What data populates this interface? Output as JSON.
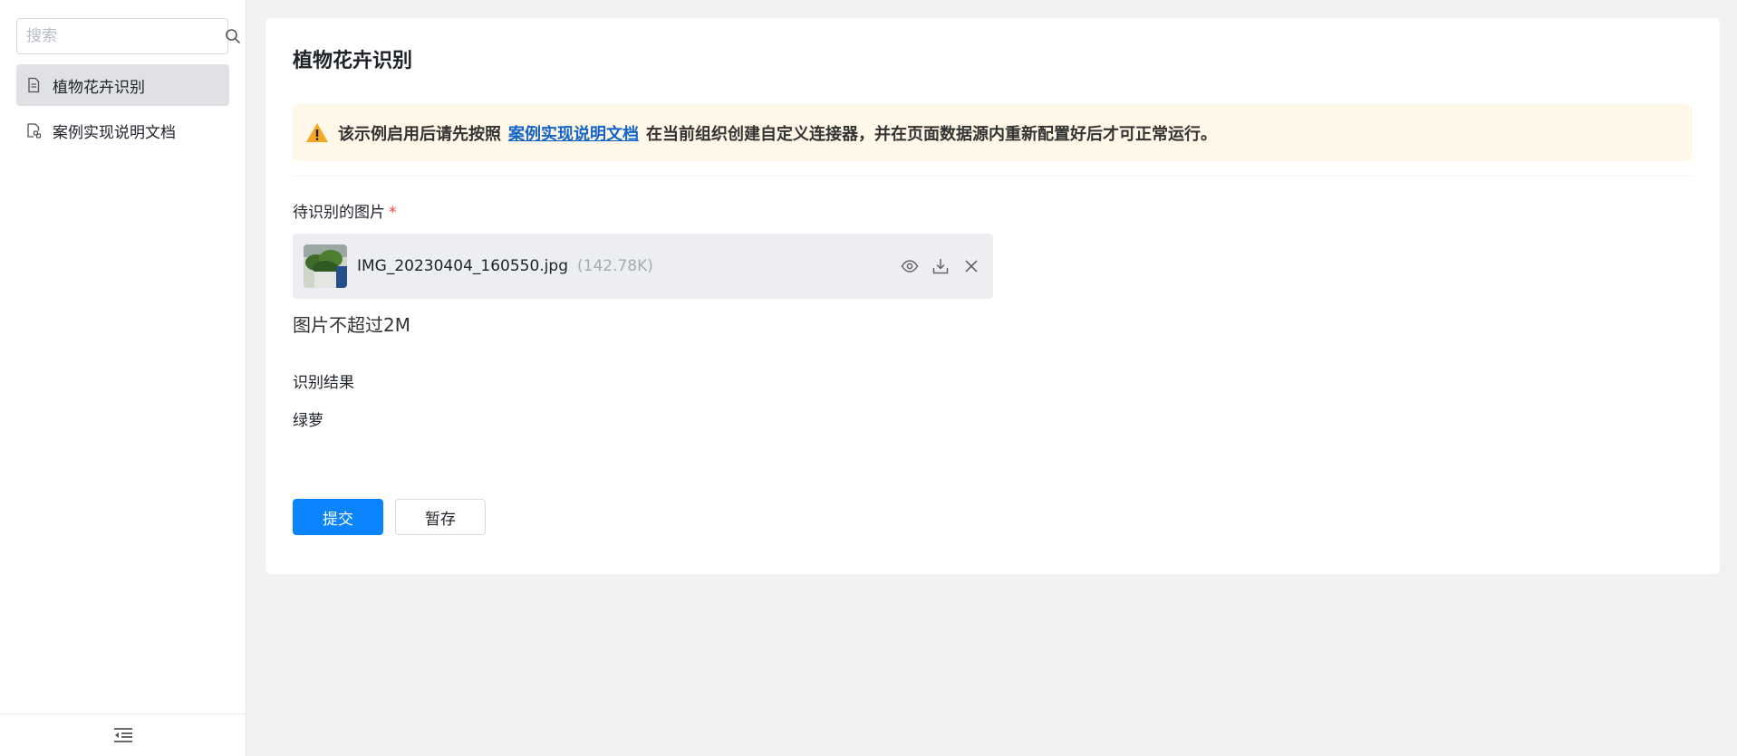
{
  "sidebar": {
    "search": {
      "placeholder": "搜索",
      "value": ""
    },
    "items": [
      {
        "label": "植物花卉识别",
        "active": true
      },
      {
        "label": "案例实现说明文档",
        "active": false
      }
    ]
  },
  "page": {
    "title": "植物花卉识别",
    "alert": {
      "prefix": "该示例启用后请先按照",
      "link": "案例实现说明文档",
      "suffix": "在当前组织创建自定义连接器，并在页面数据源内重新配置好后才可正常运行。"
    },
    "image_field": {
      "label": "待识别的图片",
      "required_mark": "*",
      "file_name": "IMG_20230404_160550.jpg",
      "file_size": "(142.78K)",
      "hint": "图片不超过2M"
    },
    "result_field": {
      "label": "识别结果",
      "value": "绿萝"
    },
    "buttons": {
      "submit": "提交",
      "save_draft": "暂存"
    }
  },
  "colors": {
    "primary": "#0a84ff",
    "link": "#1464c8",
    "alert_bg": "#fff7e8",
    "warning": "#f5a623",
    "required": "#f04134"
  },
  "icons": {
    "search": "search-icon",
    "doc": "document-icon",
    "doc_link": "document-link-icon",
    "warning": "warning-icon",
    "preview": "eye-icon",
    "download": "download-icon",
    "remove": "close-icon",
    "collapse": "collapse-sidebar-icon"
  }
}
